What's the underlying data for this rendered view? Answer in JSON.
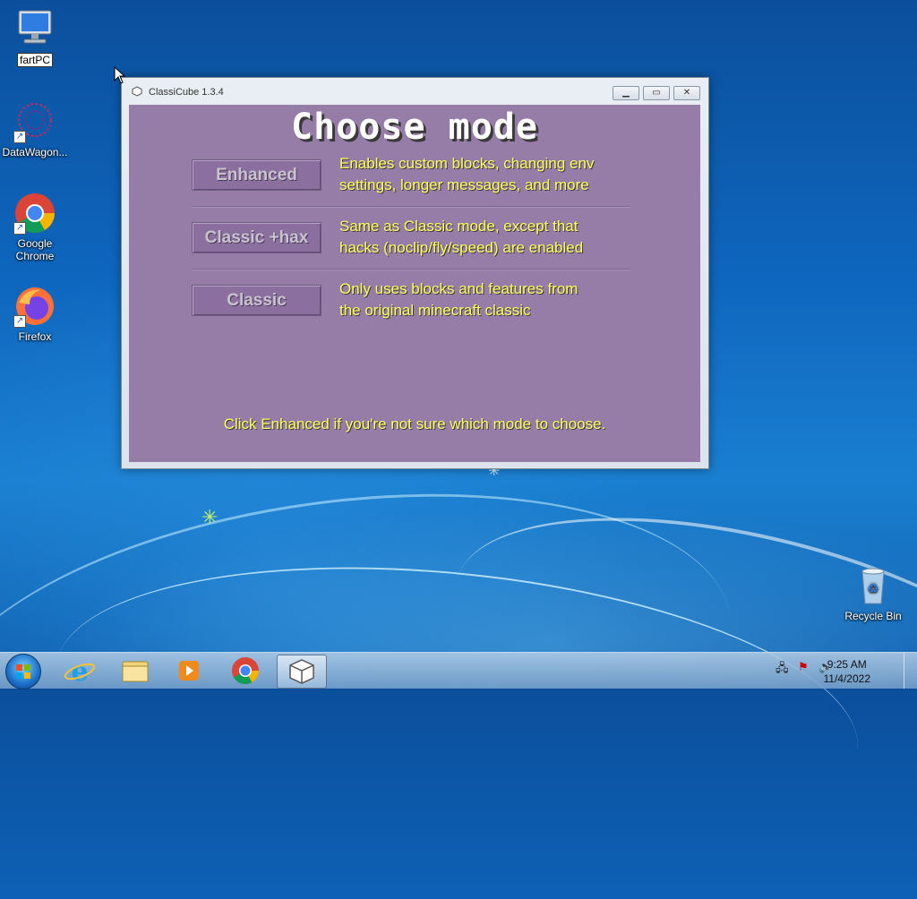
{
  "desktop": {
    "icons": [
      {
        "label": "fartPC",
        "icon": "computer-icon"
      },
      {
        "label": "DataWagon...",
        "icon": "datawagon-icon"
      },
      {
        "label": "Google Chrome",
        "icon": "chrome-icon"
      },
      {
        "label": "Firefox",
        "icon": "firefox-icon"
      },
      {
        "label": "Recycle Bin",
        "icon": "recycle-bin-icon"
      }
    ]
  },
  "window": {
    "title": "ClassiCube 1.3.4",
    "controls": {
      "minimize": "minimize-icon",
      "maximize": "maximize-icon",
      "close": "close-icon"
    },
    "heading": "Choose mode",
    "modes": [
      {
        "label": "Enhanced",
        "description_line1": "Enables custom blocks, changing env",
        "description_line2": "settings, longer messages, and more"
      },
      {
        "label": "Classic +hax",
        "description_line1": "Same as Classic mode, except that",
        "description_line2": "hacks (noclip/fly/speed) are enabled"
      },
      {
        "label": "Classic",
        "description_line1": "Only uses blocks and features from",
        "description_line2": "the original minecraft classic"
      }
    ],
    "hint": "Click Enhanced if you're not sure which mode to choose.",
    "colors": {
      "panel": "#957da8",
      "text_accent": "#ffff5a",
      "button": "#8a6f9f"
    }
  },
  "taskbar": {
    "pinned": [
      "start-orb-icon",
      "internet-explorer-icon",
      "file-explorer-icon",
      "media-player-icon",
      "chrome-icon",
      "classicube-icon"
    ],
    "tray_icons": [
      "network-icon",
      "action-center-icon",
      "volume-icon"
    ],
    "time": "9:25 AM",
    "date": "11/4/2022"
  }
}
